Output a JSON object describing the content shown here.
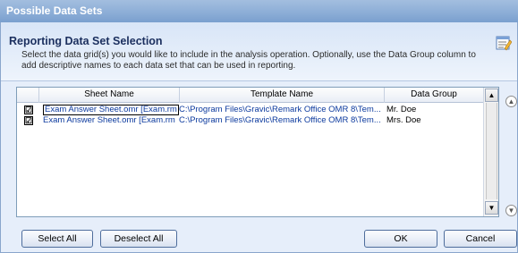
{
  "window": {
    "title": "Possible Data Sets"
  },
  "header": {
    "title": "Reporting Data Set Selection",
    "description": "Select the data grid(s) you would like to include in the analysis operation. Optionally, use the Data Group column to add descriptive names to each data set that can be used in reporting.",
    "icon": "edit-list-icon"
  },
  "grid": {
    "columns": [
      "Sheet Name",
      "Template Name",
      "Data Group"
    ],
    "rows": [
      {
        "checked": "☑",
        "sheet_name": "Exam Answer Sheet.omr [Exam.rm",
        "template_name": "C:\\Program Files\\Gravic\\Remark Office OMR 8\\Tem...",
        "data_group": "Mr. Doe"
      },
      {
        "checked": "☑",
        "sheet_name": "Exam Answer Sheet.omr [Exam.rm",
        "template_name": "C:\\Program Files\\Gravic\\Remark Office OMR 8\\Tem...",
        "data_group": "Mrs. Doe"
      }
    ]
  },
  "buttons": {
    "select_all": "Select All",
    "deselect_all": "Deselect All",
    "ok": "OK",
    "cancel": "Cancel"
  },
  "colors": {
    "titlebar": "#8daed7",
    "header_text": "#1b2f5e",
    "link_text": "#0c3a9e"
  }
}
